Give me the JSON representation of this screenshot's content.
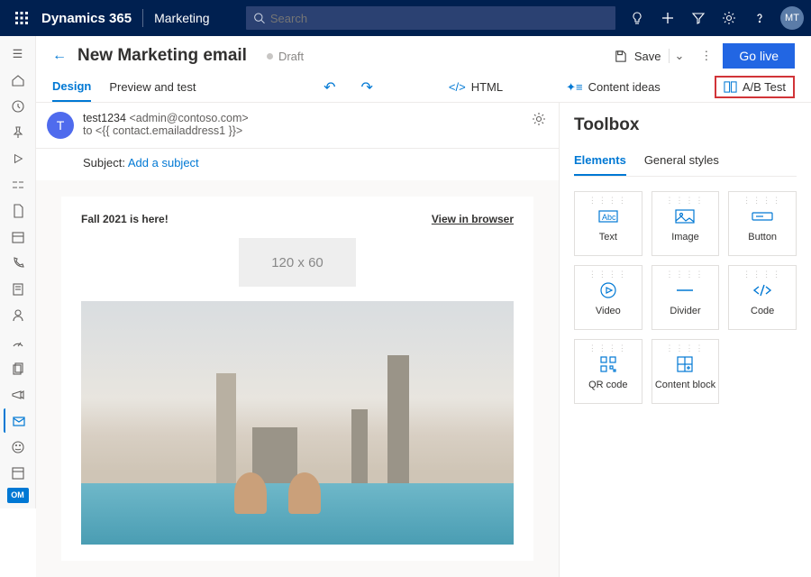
{
  "topbar": {
    "brand": "Dynamics 365",
    "module": "Marketing",
    "search_placeholder": "Search",
    "avatar": "MT"
  },
  "leftnav": {
    "om": "OM"
  },
  "page": {
    "title": "New Marketing email",
    "status": "Draft",
    "save": "Save",
    "golive": "Go live"
  },
  "tabs": {
    "design": "Design",
    "preview": "Preview and test",
    "html": "HTML",
    "ideas": "Content ideas",
    "abtest": "A/B Test"
  },
  "email": {
    "from_name": "test1234",
    "from_addr": "<admin@contoso.com>",
    "to_prefix": "to ",
    "to_token": "<{{ contact.emailaddress1 }}>",
    "subject_label": "Subject:",
    "subject_link": "Add a subject",
    "headline": "Fall 2021 is here!",
    "view_browser": "View in browser",
    "placeholder": "120 x 60"
  },
  "toolbox": {
    "title": "Toolbox",
    "tab_elements": "Elements",
    "tab_styles": "General styles",
    "items": [
      {
        "label": "Text"
      },
      {
        "label": "Image"
      },
      {
        "label": "Button"
      },
      {
        "label": "Video"
      },
      {
        "label": "Divider"
      },
      {
        "label": "Code"
      },
      {
        "label": "QR code"
      },
      {
        "label": "Content block"
      }
    ]
  }
}
